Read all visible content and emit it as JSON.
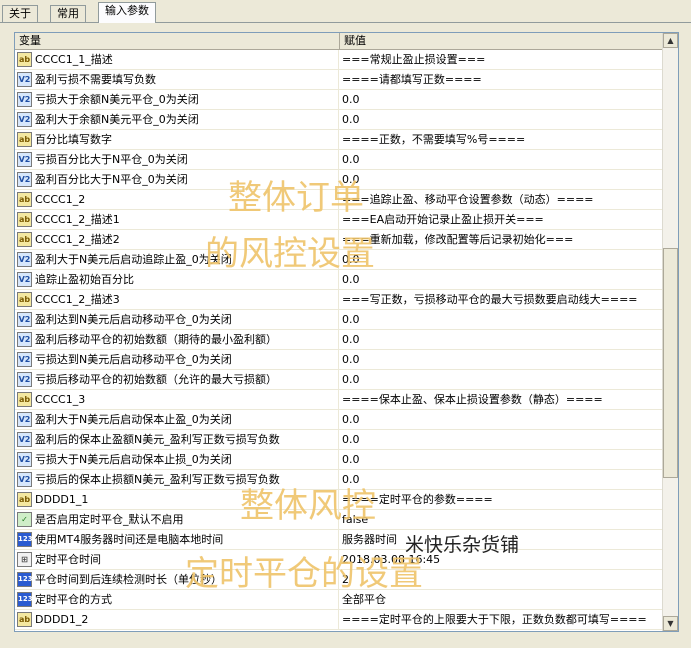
{
  "tabs": [
    "关于",
    "常用",
    "输入参数"
  ],
  "active_tab": 2,
  "columns": {
    "name": "变量",
    "value": "赋值"
  },
  "rows": [
    {
      "icon": "ab",
      "name": "CCCC1_1_描述",
      "value": "===常规止盈止损设置==="
    },
    {
      "icon": "v2",
      "name": "盈利亏损不需要填写负数",
      "value": "====请都填写正数===="
    },
    {
      "icon": "v2",
      "name": "亏损大于余额N美元平仓_0为关闭",
      "value": "0.0"
    },
    {
      "icon": "v2",
      "name": "盈利大于余额N美元平仓_0为关闭",
      "value": "0.0"
    },
    {
      "icon": "ab",
      "name": "百分比填写数字",
      "value": "====正数，不需要填写%号===="
    },
    {
      "icon": "v2",
      "name": "亏损百分比大于N平仓_0为关闭",
      "value": "0.0"
    },
    {
      "icon": "v2",
      "name": "盈利百分比大于N平仓_0为关闭",
      "value": "0.0"
    },
    {
      "icon": "ab",
      "name": "CCCC1_2",
      "value": "===追踪止盈、移动平仓设置参数（动态）===="
    },
    {
      "icon": "ab",
      "name": "CCCC1_2_描述1",
      "value": "===EA启动开始记录止盈止损开关==="
    },
    {
      "icon": "ab",
      "name": "CCCC1_2_描述2",
      "value": "===重新加载，修改配置等后记录初始化==="
    },
    {
      "icon": "v2",
      "name": "盈利大于N美元后启动追踪止盈_0为关闭",
      "value": "0.0"
    },
    {
      "icon": "v2",
      "name": "追踪止盈初始百分比",
      "value": "0.0"
    },
    {
      "icon": "ab",
      "name": "CCCC1_2_描述3",
      "value": "===写正数，亏损移动平仓的最大亏损数要启动线大===="
    },
    {
      "icon": "v2",
      "name": "盈利达到N美元后启动移动平仓_0为关闭",
      "value": "0.0"
    },
    {
      "icon": "v2",
      "name": "盈利后移动平仓的初始数额（期待的最小盈利额）",
      "value": "0.0"
    },
    {
      "icon": "v2",
      "name": "亏损达到N美元后启动移动平仓_0为关闭",
      "value": "0.0"
    },
    {
      "icon": "v2",
      "name": "亏损后移动平仓的初始数额（允许的最大亏损额）",
      "value": "0.0"
    },
    {
      "icon": "ab",
      "name": "CCCC1_3",
      "value": "====保本止盈、保本止损设置参数（静态）===="
    },
    {
      "icon": "v2",
      "name": "盈利大于N美元后启动保本止盈_0为关闭",
      "value": "0.0"
    },
    {
      "icon": "v2",
      "name": "盈利后的保本止盈额N美元_盈利写正数亏损写负数",
      "value": "0.0"
    },
    {
      "icon": "v2",
      "name": "亏损大于N美元后启动保本止损_0为关闭",
      "value": "0.0"
    },
    {
      "icon": "v2",
      "name": "亏损后的保本止损额N美元_盈利写正数亏损写负数",
      "value": "0.0"
    },
    {
      "icon": "ab",
      "name": "DDDD1_1",
      "value": "====定时平仓的参数===="
    },
    {
      "icon": "bool",
      "name": "是否启用定时平仓_默认不启用",
      "value": "false"
    },
    {
      "icon": "n123",
      "name": "使用MT4服务器时间还是电脑本地时间",
      "value": "服务器时间"
    },
    {
      "icon": "dt",
      "name": "定时平仓时间",
      "value": "2018.03.08 16:45"
    },
    {
      "icon": "n123",
      "name": "平仓时间到后连续检测时长（单位秒）",
      "value": "2"
    },
    {
      "icon": "n123",
      "name": "定时平仓的方式",
      "value": "全部平仓"
    },
    {
      "icon": "ab",
      "name": "DDDD1_2",
      "value": "====定时平仓的上限要大于下限，正数负数都可填写===="
    }
  ],
  "icon_labels": {
    "ab": "ab",
    "v2": "V2",
    "n123": "123",
    "bool": "✓",
    "dt": "⊞"
  },
  "watermarks": {
    "line1": "整体订单",
    "line2": "的风控设置",
    "line3": "整体风控",
    "line4": "定时平仓的设置",
    "shop": "米快乐杂货铺"
  },
  "colors": {
    "watermark": "#efc46a",
    "icon_blue": "#2a5bd1"
  }
}
